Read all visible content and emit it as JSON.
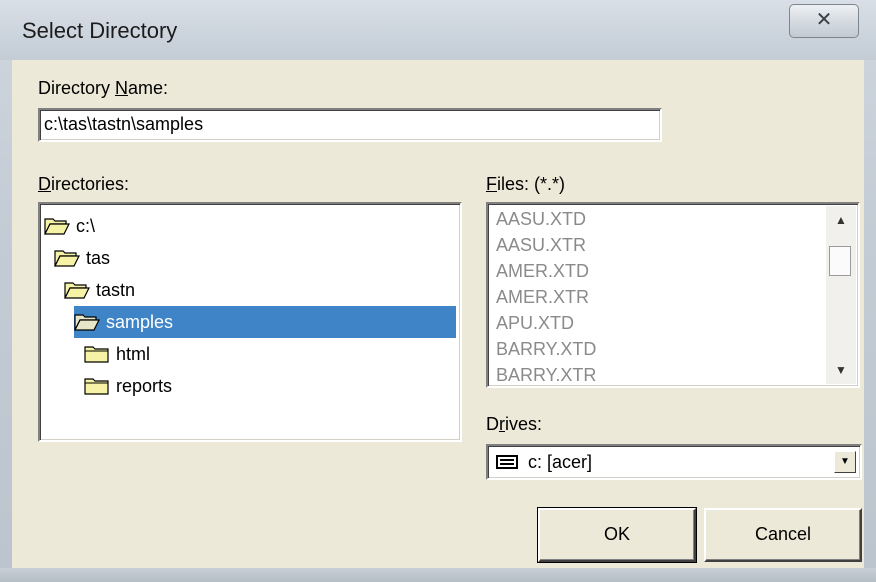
{
  "window": {
    "title": "Select Directory",
    "close_glyph": "✕"
  },
  "directory_name": {
    "label_pre": "Directory ",
    "label_mnemonic": "N",
    "label_post": "ame:",
    "value": "c:\\tas\\tastn\\samples"
  },
  "directories": {
    "label_mnemonic": "D",
    "label_post": "irectories:",
    "items": [
      {
        "label": "c:\\",
        "icon": "open-folder-icon",
        "selected": false
      },
      {
        "label": "tas",
        "icon": "open-folder-icon",
        "selected": false
      },
      {
        "label": "tastn",
        "icon": "open-folder-icon",
        "selected": false
      },
      {
        "label": "samples",
        "icon": "open-folder-icon",
        "selected": true
      },
      {
        "label": "html",
        "icon": "closed-folder-icon",
        "selected": false
      },
      {
        "label": "reports",
        "icon": "closed-folder-icon",
        "selected": false
      }
    ]
  },
  "files": {
    "label_mnemonic": "F",
    "label_post": "iles: (*.*)",
    "items": [
      "AASU.XTD",
      "AASU.XTR",
      "AMER.XTD",
      "AMER.XTR",
      "APU.XTD",
      "BARRY.XTD",
      "BARRY.XTR"
    ]
  },
  "drives": {
    "label_pre": "D",
    "label_mnemonic": "r",
    "label_post": "ives:",
    "value": "c: [acer]"
  },
  "buttons": {
    "ok": "OK",
    "cancel": "Cancel"
  },
  "colors": {
    "selection": "#3e84c6",
    "dialog_face": "#ece9d8",
    "disabled_text": "#8a8a8a"
  }
}
